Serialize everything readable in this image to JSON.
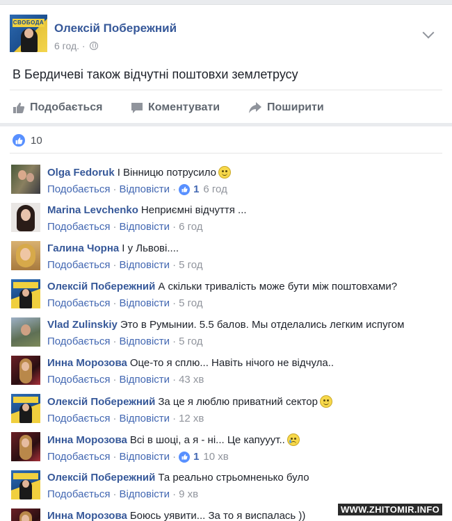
{
  "post": {
    "author": "Олексій Побережний",
    "avatar_text": "СВОБОДА",
    "time": "6 год.",
    "separator": "·",
    "privacy_icon": "globe-icon",
    "text": "В Бердичеві також відчутні поштовхи землетрусу"
  },
  "actions": {
    "like": "Подобається",
    "comment": "Коментувати",
    "share": "Поширити"
  },
  "reactions": {
    "count": "10"
  },
  "comment_labels": {
    "like": "Подобається",
    "reply": "Відповісти",
    "sep": "·"
  },
  "comments": [
    {
      "author": "Olga Fedoruk",
      "text": "І Вінницю потрусило",
      "emoji": "smile",
      "likes": "1",
      "time": "6 год",
      "avatar": "olga"
    },
    {
      "author": "Marina Levchenko",
      "text": "Неприємні відчуття ...",
      "emoji": "",
      "likes": "",
      "time": "6 год",
      "avatar": "marina"
    },
    {
      "author": "Галина Чорна",
      "text": "І у Львові....",
      "emoji": "",
      "likes": "",
      "time": "5 год",
      "avatar": "galyna"
    },
    {
      "author": "Олексій Побережний",
      "text": "А скільки тривалість може бути між поштовхами?",
      "emoji": "",
      "likes": "",
      "time": "5 год",
      "avatar": "svoboda"
    },
    {
      "author": "Vlad Zulinskiy",
      "text": "Это в Румынии. 5.5 балов. Мы отделались легким испугом",
      "emoji": "",
      "likes": "",
      "time": "5 год",
      "avatar": "vlad"
    },
    {
      "author": "Инна Морозова",
      "text": "Оце-то я сплю... Навіть нічого не відчула..",
      "emoji": "",
      "likes": "",
      "time": "43 хв",
      "avatar": "inna"
    },
    {
      "author": "Олексій Побережний",
      "text": "За це я люблю приватний сектор",
      "emoji": "smile",
      "likes": "",
      "time": "12 хв",
      "avatar": "svoboda"
    },
    {
      "author": "Инна Морозова",
      "text": "Всі в шоці, а я - ні... Це капууут..",
      "emoji": "sad",
      "likes": "1",
      "time": "10 хв",
      "avatar": "inna"
    },
    {
      "author": "Олексій Побережний",
      "text": "Та реально стрьомненько було",
      "emoji": "",
      "likes": "",
      "time": "9 хв",
      "avatar": "svoboda"
    },
    {
      "author": "Инна Морозова",
      "text": "Боюсь уявити... За то я виспалась ))",
      "emoji": "",
      "likes": "",
      "time": "",
      "avatar": "inna"
    }
  ],
  "watermark": "WWW.ZHITOMIR.INFO",
  "colors": {
    "link": "#365899",
    "meta": "#90949c",
    "like_blue": "#5890ff"
  }
}
